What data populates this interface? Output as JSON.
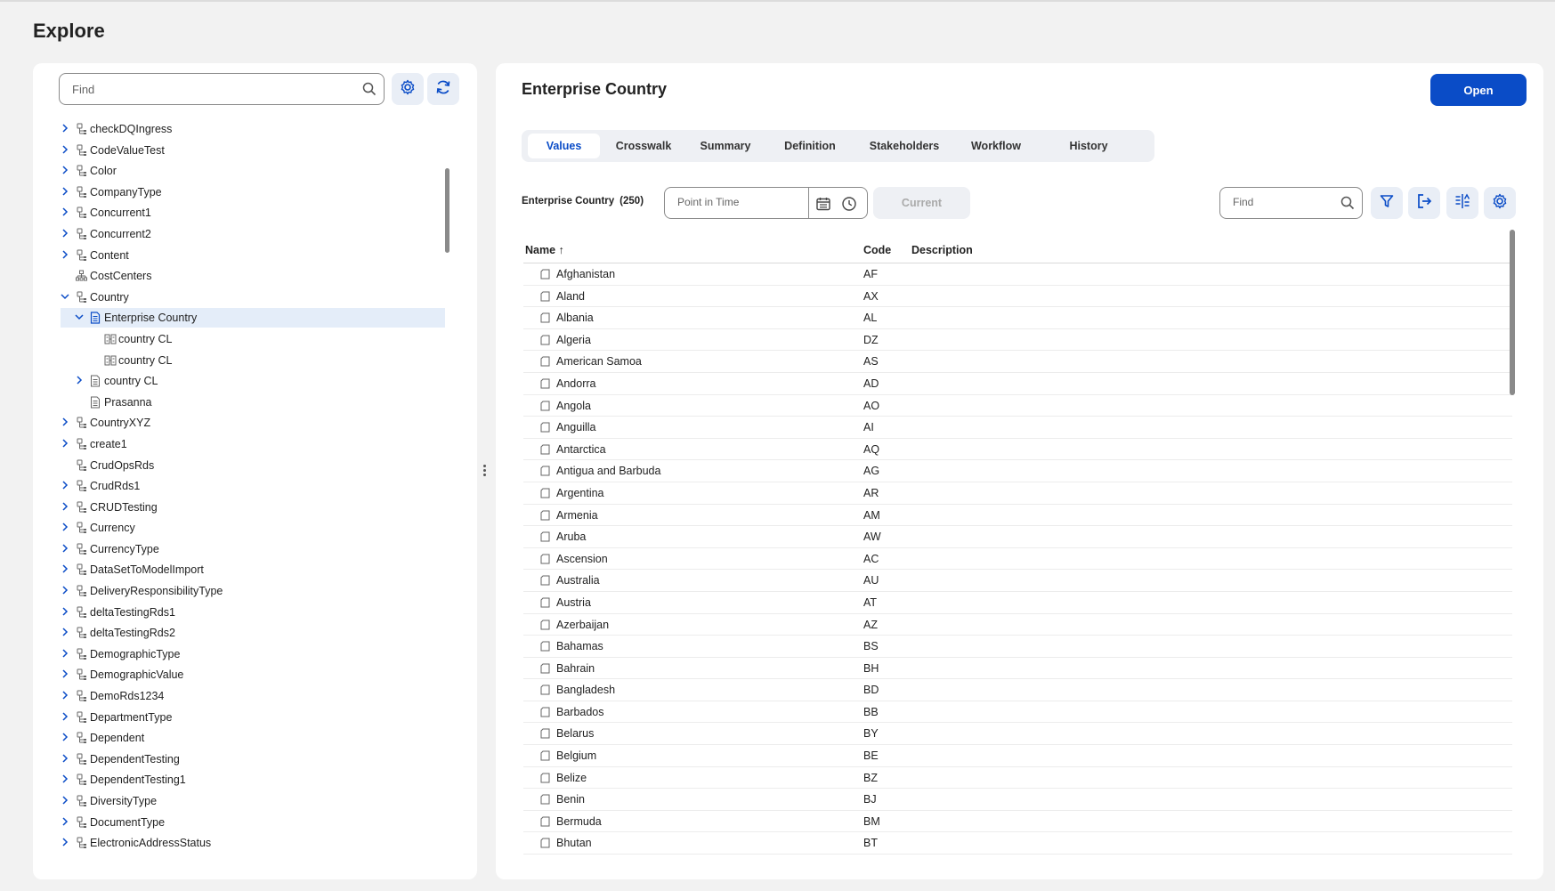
{
  "page": {
    "title": "Explore"
  },
  "left": {
    "search_placeholder": "Find",
    "tree": [
      {
        "label": "checkDQIngress",
        "level": 0,
        "chevron": "right",
        "icon": "hierarchy"
      },
      {
        "label": "CodeValueTest",
        "level": 0,
        "chevron": "right",
        "icon": "hierarchy"
      },
      {
        "label": "Color",
        "level": 0,
        "chevron": "right",
        "icon": "hierarchy"
      },
      {
        "label": "CompanyType",
        "level": 0,
        "chevron": "right",
        "icon": "hierarchy"
      },
      {
        "label": "Concurrent1",
        "level": 0,
        "chevron": "right",
        "icon": "hierarchy"
      },
      {
        "label": "Concurrent2",
        "level": 0,
        "chevron": "right",
        "icon": "hierarchy"
      },
      {
        "label": "Content",
        "level": 0,
        "chevron": "right",
        "icon": "hierarchy"
      },
      {
        "label": "CostCenters",
        "level": 0,
        "chevron": "none",
        "icon": "org"
      },
      {
        "label": "Country",
        "level": 0,
        "chevron": "down",
        "icon": "hierarchy"
      },
      {
        "label": "Enterprise Country",
        "level": 1,
        "chevron": "down",
        "icon": "doc-blue",
        "selected": true
      },
      {
        "label": "country CL",
        "level": 2,
        "chevron": "none",
        "icon": "map"
      },
      {
        "label": "country CL",
        "level": 2,
        "chevron": "none",
        "icon": "map"
      },
      {
        "label": "country CL",
        "level": 1,
        "chevron": "right",
        "icon": "doc"
      },
      {
        "label": "Prasanna",
        "level": 1,
        "chevron": "none",
        "icon": "doc"
      },
      {
        "label": "CountryXYZ",
        "level": 0,
        "chevron": "right",
        "icon": "hierarchy"
      },
      {
        "label": "create1",
        "level": 0,
        "chevron": "right",
        "icon": "hierarchy"
      },
      {
        "label": "CrudOpsRds",
        "level": 0,
        "chevron": "none",
        "icon": "hierarchy"
      },
      {
        "label": "CrudRds1",
        "level": 0,
        "chevron": "right",
        "icon": "hierarchy"
      },
      {
        "label": "CRUDTesting",
        "level": 0,
        "chevron": "right",
        "icon": "hierarchy"
      },
      {
        "label": "Currency",
        "level": 0,
        "chevron": "right",
        "icon": "hierarchy"
      },
      {
        "label": "CurrencyType",
        "level": 0,
        "chevron": "right",
        "icon": "hierarchy"
      },
      {
        "label": "DataSetToModelImport",
        "level": 0,
        "chevron": "right",
        "icon": "hierarchy"
      },
      {
        "label": "DeliveryResponsibilityType",
        "level": 0,
        "chevron": "right",
        "icon": "hierarchy"
      },
      {
        "label": "deltaTestingRds1",
        "level": 0,
        "chevron": "right",
        "icon": "hierarchy"
      },
      {
        "label": "deltaTestingRds2",
        "level": 0,
        "chevron": "right",
        "icon": "hierarchy"
      },
      {
        "label": "DemographicType",
        "level": 0,
        "chevron": "right",
        "icon": "hierarchy"
      },
      {
        "label": "DemographicValue",
        "level": 0,
        "chevron": "right",
        "icon": "hierarchy"
      },
      {
        "label": "DemoRds1234",
        "level": 0,
        "chevron": "right",
        "icon": "hierarchy"
      },
      {
        "label": "DepartmentType",
        "level": 0,
        "chevron": "right",
        "icon": "hierarchy"
      },
      {
        "label": "Dependent",
        "level": 0,
        "chevron": "right",
        "icon": "hierarchy"
      },
      {
        "label": "DependentTesting",
        "level": 0,
        "chevron": "right",
        "icon": "hierarchy"
      },
      {
        "label": "DependentTesting1",
        "level": 0,
        "chevron": "right",
        "icon": "hierarchy"
      },
      {
        "label": "DiversityType",
        "level": 0,
        "chevron": "right",
        "icon": "hierarchy"
      },
      {
        "label": "DocumentType",
        "level": 0,
        "chevron": "right",
        "icon": "hierarchy"
      },
      {
        "label": "ElectronicAddressStatus",
        "level": 0,
        "chevron": "right",
        "icon": "hierarchy"
      }
    ]
  },
  "right": {
    "title": "Enterprise Country",
    "open_label": "Open",
    "tabs": [
      {
        "label": "Values",
        "active": true
      },
      {
        "label": "Crosswalk"
      },
      {
        "label": "Summary"
      },
      {
        "label": "Definition"
      },
      {
        "label": "Stakeholders"
      },
      {
        "label": "Workflow"
      },
      {
        "label": "History"
      }
    ],
    "toolbar": {
      "entity_label": "Enterprise Country",
      "count": "(250)",
      "point_in_time_placeholder": "Point in Time",
      "current_label": "Current",
      "find_placeholder": "Find"
    },
    "columns": {
      "name": "Name ↑",
      "code": "Code",
      "description": "Description"
    },
    "rows": [
      {
        "name": "Afghanistan",
        "code": "AF"
      },
      {
        "name": "Aland",
        "code": "AX"
      },
      {
        "name": "Albania",
        "code": "AL"
      },
      {
        "name": "Algeria",
        "code": "DZ"
      },
      {
        "name": "American Samoa",
        "code": "AS"
      },
      {
        "name": "Andorra",
        "code": "AD"
      },
      {
        "name": "Angola",
        "code": "AO"
      },
      {
        "name": "Anguilla",
        "code": "AI"
      },
      {
        "name": "Antarctica",
        "code": "AQ"
      },
      {
        "name": "Antigua and Barbuda",
        "code": "AG"
      },
      {
        "name": "Argentina",
        "code": "AR"
      },
      {
        "name": "Armenia",
        "code": "AM"
      },
      {
        "name": "Aruba",
        "code": "AW"
      },
      {
        "name": "Ascension",
        "code": "AC"
      },
      {
        "name": "Australia",
        "code": "AU"
      },
      {
        "name": "Austria",
        "code": "AT"
      },
      {
        "name": "Azerbaijan",
        "code": "AZ"
      },
      {
        "name": "Bahamas",
        "code": "BS"
      },
      {
        "name": "Bahrain",
        "code": "BH"
      },
      {
        "name": "Bangladesh",
        "code": "BD"
      },
      {
        "name": "Barbados",
        "code": "BB"
      },
      {
        "name": "Belarus",
        "code": "BY"
      },
      {
        "name": "Belgium",
        "code": "BE"
      },
      {
        "name": "Belize",
        "code": "BZ"
      },
      {
        "name": "Benin",
        "code": "BJ"
      },
      {
        "name": "Bermuda",
        "code": "BM"
      },
      {
        "name": "Bhutan",
        "code": "BT"
      }
    ]
  },
  "colors": {
    "accent": "#0a4cc7",
    "selected_row": "#e4edf9",
    "icon_button_bg": "#e9eef6"
  }
}
